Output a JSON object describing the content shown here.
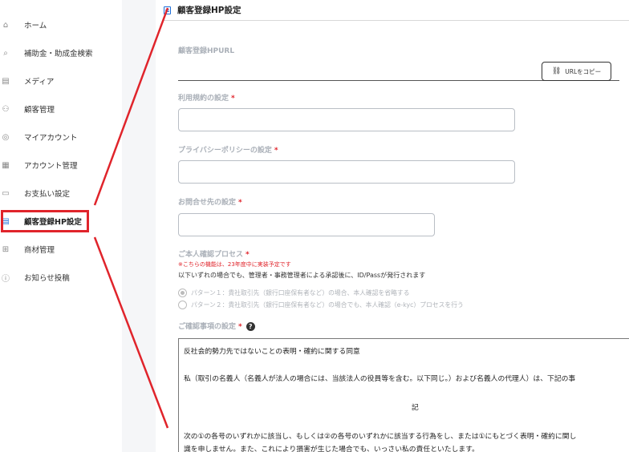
{
  "sidebar": {
    "items": [
      {
        "label": "ホーム",
        "icon": "home-icon",
        "glyph": "⌂"
      },
      {
        "label": "補助金・助成金検索",
        "icon": "search-icon",
        "glyph": "⌕"
      },
      {
        "label": "メディア",
        "icon": "media-icon",
        "glyph": "▤"
      },
      {
        "label": "顧客管理",
        "icon": "customer-icon",
        "glyph": "⚇"
      },
      {
        "label": "マイアカウント",
        "icon": "account-icon",
        "glyph": "◎"
      },
      {
        "label": "アカウント管理",
        "icon": "account-manage-icon",
        "glyph": "▦"
      },
      {
        "label": "お支払い設定",
        "icon": "payment-icon",
        "glyph": "▭"
      },
      {
        "label": "顧客登録HP設定",
        "icon": "document-icon",
        "glyph": "▤"
      },
      {
        "label": "商材管理",
        "icon": "gift-icon",
        "glyph": "⊞"
      },
      {
        "label": "お知らせ投稿",
        "icon": "info-icon",
        "glyph": "ⓘ"
      }
    ]
  },
  "page": {
    "title": "顧客登録HP設定"
  },
  "form": {
    "url_label": "顧客登録HPURL",
    "copy_button": "URLをコピー",
    "terms_label": "利用規約の設定",
    "privacy_label": "プライバシーポリシーの設定",
    "contact_label": "お問合せ先の設定",
    "identity_label": "ご本人確認プロセス",
    "required_mark": "*",
    "identity_notice": "※こちらの機能は、23年度中に実装予定です",
    "identity_desc": "以下いずれの場合でも、管理者・事務管理者による承認後に、ID/Passが発行されます",
    "pattern1": "パターン１：貴社取引先（銀行口座保有者など）の場合、本人確認を省略する",
    "pattern2": "パターン２：貴社取引先（銀行口座保有者など）の場合でも、本人確認（e-kyc）プロセスを行う",
    "confirm_label": "ご確認事項の設定",
    "help_glyph": "?",
    "confirm_text": {
      "line1": "反社会的勢力先ではないことの表明・確約に関する同意",
      "line2": "私（取引の名義人（名義人が法人の場合には、当該法人の役員等を含む。以下同じ。）および名義人の代理人）は、下記の事",
      "line3": "記",
      "line4": "次の①の各号のいずれかに該当し、もしくは②の各号のいずれかに該当する行為をし、または①にもとづく表明・確約に関し",
      "line5": "識を申しません。また、これにより損害が生じた場合でも、いっさい私の責任といたします。"
    }
  },
  "colors": {
    "accent": "#1e6fd9",
    "annotation": "#e0242b",
    "label_muted": "#aab0b8"
  }
}
